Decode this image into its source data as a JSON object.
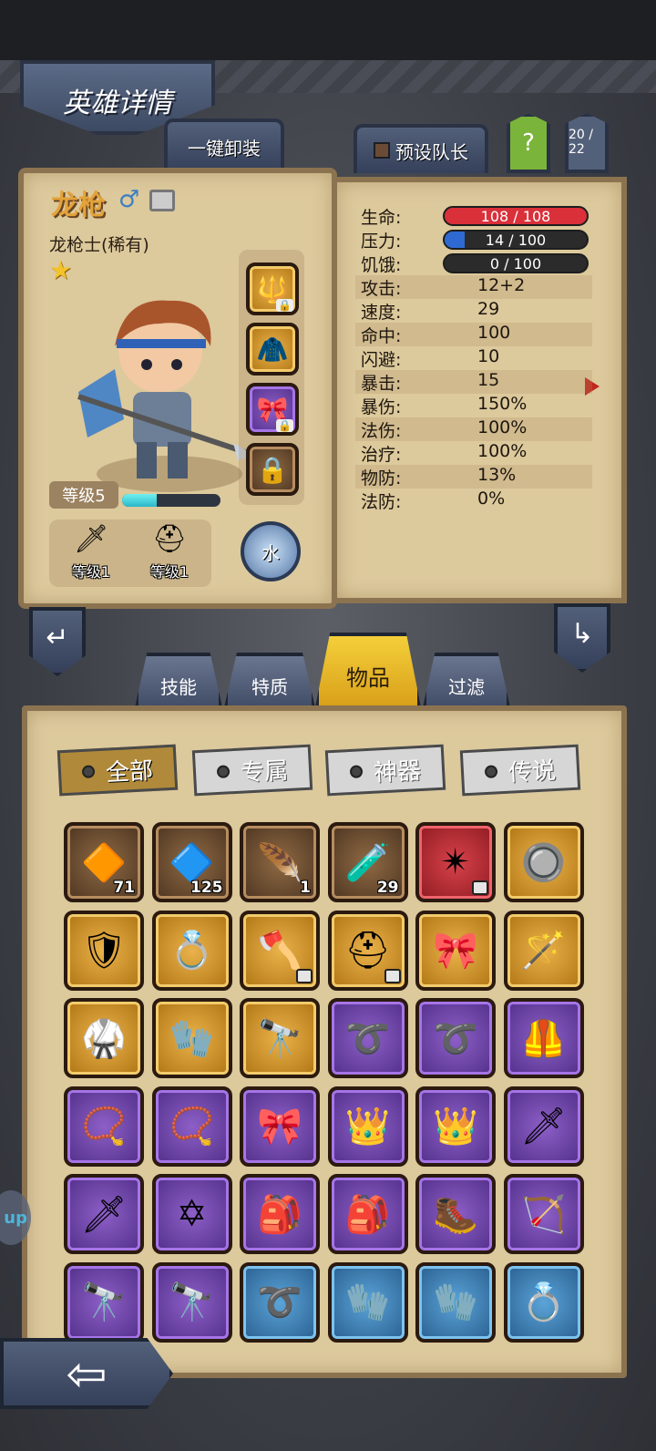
{
  "header": {
    "title": "英雄详情",
    "unequip_label": "一键卸装",
    "preset_leader_label": "预设队长",
    "help_label": "?",
    "roster_count": "20 / 22"
  },
  "hero": {
    "name": "龙枪",
    "class": "龙枪士(稀有)",
    "level_label": "等级5",
    "xp_fraction": 0.35,
    "weapon_level": "等级1",
    "armor_level": "等级1",
    "element": "水"
  },
  "stats": {
    "hp": {
      "label": "生命:",
      "value": "108 / 108",
      "fraction": 1.0,
      "color": "#d9303a"
    },
    "stress": {
      "label": "压力:",
      "value": "14 / 100",
      "fraction": 0.14,
      "color": "#2e6ad1"
    },
    "hunger": {
      "label": "饥饿:",
      "value": "0 / 100",
      "fraction": 0.0,
      "color": "#888888"
    },
    "rows": [
      {
        "label": "攻击:",
        "value": "12+2"
      },
      {
        "label": "速度:",
        "value": "29"
      },
      {
        "label": "命中:",
        "value": "100"
      },
      {
        "label": "闪避:",
        "value": "10"
      },
      {
        "label": "暴击:",
        "value": "15"
      },
      {
        "label": "暴伤:",
        "value": "150%"
      },
      {
        "label": "法伤:",
        "value": "100%"
      },
      {
        "label": "治疗:",
        "value": "100%"
      },
      {
        "label": "物防:",
        "value": "13%"
      },
      {
        "label": "法防:",
        "value": "0%"
      }
    ]
  },
  "tabs": {
    "skills": "技能",
    "traits": "特质",
    "items": "物品",
    "filter": "过滤"
  },
  "filters": {
    "all": "全部",
    "exclusive": "专属",
    "artifact": "神器",
    "legendary": "传说"
  },
  "inventory": [
    {
      "icon": "gem-icon",
      "glyph": "🔶",
      "rarity": "brown",
      "count": "71"
    },
    {
      "icon": "crystal-icon",
      "glyph": "🔷",
      "rarity": "brown",
      "count": "125"
    },
    {
      "icon": "feather-icon",
      "glyph": "🪶",
      "rarity": "brown",
      "count": "1"
    },
    {
      "icon": "potion-icon",
      "glyph": "🧪",
      "rarity": "brown",
      "count": "29"
    },
    {
      "icon": "shuriken-icon",
      "glyph": "✴",
      "rarity": "red",
      "locked": true
    },
    {
      "icon": "amulet-icon",
      "glyph": "🔘",
      "rarity": "gold"
    },
    {
      "icon": "shield-icon",
      "glyph": "🛡",
      "rarity": "gold"
    },
    {
      "icon": "ring-icon",
      "glyph": "💍",
      "rarity": "gold"
    },
    {
      "icon": "axe-icon",
      "glyph": "🪓",
      "rarity": "gold",
      "locked": true
    },
    {
      "icon": "helmet-icon",
      "glyph": "⛑",
      "rarity": "gold",
      "locked": true
    },
    {
      "icon": "headband-icon",
      "glyph": "🎀",
      "rarity": "gold"
    },
    {
      "icon": "staff-icon",
      "glyph": "🪄",
      "rarity": "gold"
    },
    {
      "icon": "armor-icon",
      "glyph": "🥋",
      "rarity": "gold"
    },
    {
      "icon": "gauntlet-icon",
      "glyph": "🧤",
      "rarity": "gold"
    },
    {
      "icon": "telescope-icon",
      "glyph": "🔭",
      "rarity": "gold"
    },
    {
      "icon": "whip-icon",
      "glyph": "➰",
      "rarity": "purple"
    },
    {
      "icon": "whip-icon",
      "glyph": "➰",
      "rarity": "purple"
    },
    {
      "icon": "chestplate-icon",
      "glyph": "🦺",
      "rarity": "purple"
    },
    {
      "icon": "necklace-icon",
      "glyph": "📿",
      "rarity": "purple"
    },
    {
      "icon": "necklace-icon",
      "glyph": "📿",
      "rarity": "purple"
    },
    {
      "icon": "headband-icon",
      "glyph": "🎀",
      "rarity": "purple"
    },
    {
      "icon": "tiara-icon",
      "glyph": "👑",
      "rarity": "purple"
    },
    {
      "icon": "tiara-icon",
      "glyph": "👑",
      "rarity": "purple"
    },
    {
      "icon": "sword-icon",
      "glyph": "🗡",
      "rarity": "purple"
    },
    {
      "icon": "sword-icon",
      "glyph": "🗡",
      "rarity": "purple"
    },
    {
      "icon": "star-medal-icon",
      "glyph": "✡",
      "rarity": "purple"
    },
    {
      "icon": "backpack-icon",
      "glyph": "🎒",
      "rarity": "purple"
    },
    {
      "icon": "backpack-icon",
      "glyph": "🎒",
      "rarity": "purple"
    },
    {
      "icon": "boots-icon",
      "glyph": "🥾",
      "rarity": "purple"
    },
    {
      "icon": "crossbow-icon",
      "glyph": "🏹",
      "rarity": "purple"
    },
    {
      "icon": "telescope-icon",
      "glyph": "🔭",
      "rarity": "purple"
    },
    {
      "icon": "telescope-icon",
      "glyph": "🔭",
      "rarity": "purple"
    },
    {
      "icon": "whip-icon",
      "glyph": "➰",
      "rarity": "blue"
    },
    {
      "icon": "claw-glove-icon",
      "glyph": "🧤",
      "rarity": "blue"
    },
    {
      "icon": "claw-glove-icon",
      "glyph": "🧤",
      "rarity": "blue"
    },
    {
      "icon": "gem-ring-icon",
      "glyph": "💍",
      "rarity": "blue"
    }
  ],
  "side_tag": "up",
  "colors": {
    "parchment": "#dcc99c",
    "accent_gold": "#e3a33b",
    "frame": "#35405a"
  }
}
